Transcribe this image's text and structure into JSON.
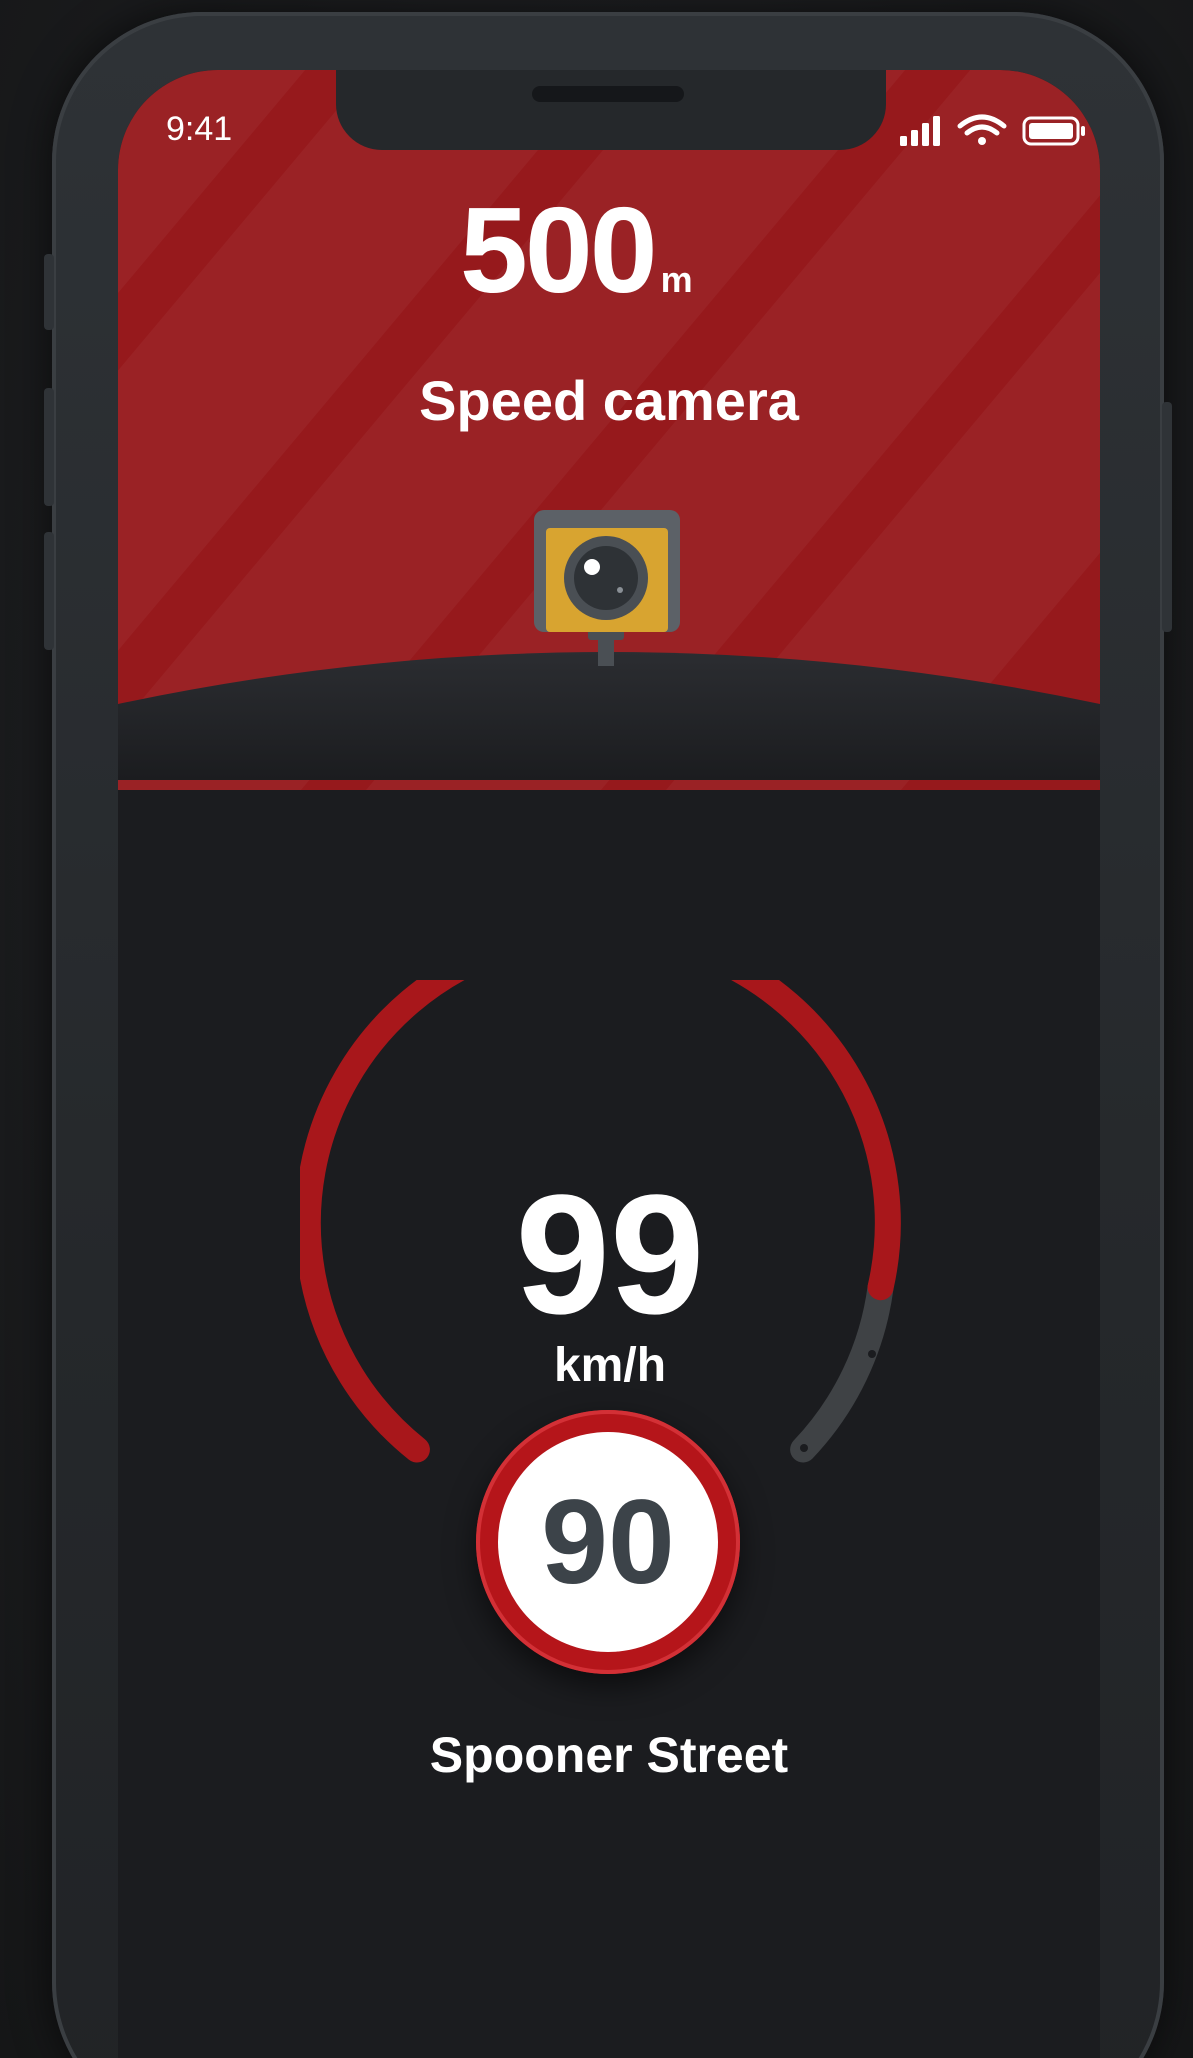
{
  "status_bar": {
    "time": "9:41",
    "icons": [
      "signal-icon",
      "wifi-icon",
      "battery-icon"
    ]
  },
  "alert": {
    "distance_value": "500",
    "distance_unit": "m",
    "label": "Speed camera",
    "icon": "speed-camera-icon"
  },
  "speedometer": {
    "current_speed": "99",
    "unit": "km/h",
    "speed_limit": "90"
  },
  "location": {
    "street": "Spooner Street"
  },
  "colors": {
    "banner": "#96191c",
    "background": "#1b1c1f",
    "ring_active": "#a8171b",
    "ring_inactive": "#3f4245",
    "sign_border": "#b5151a",
    "sign_text": "#3c4349",
    "camera_body": "#d8a430"
  }
}
